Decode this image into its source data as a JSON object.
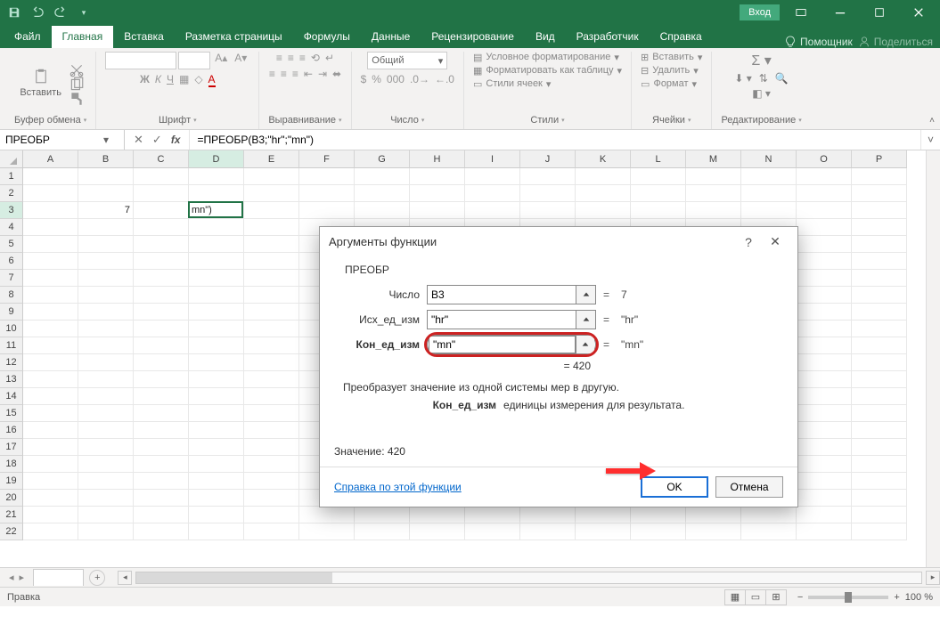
{
  "titlebar": {
    "login": "Вход"
  },
  "tabs": {
    "file": "Файл",
    "items": [
      "Главная",
      "Вставка",
      "Разметка страницы",
      "Формулы",
      "Данные",
      "Рецензирование",
      "Вид",
      "Разработчик",
      "Справка"
    ],
    "active": 0,
    "helper": "Помощник",
    "share": "Поделиться"
  },
  "ribbon": {
    "paste": "Вставить",
    "groups": {
      "clipboard": "Буфер обмена",
      "font": "Шрифт",
      "alignment": "Выравнивание",
      "number": "Число",
      "styles": "Стили",
      "cells": "Ячейки",
      "editing": "Редактирование"
    },
    "number_format": "Общий",
    "cond_format": "Условное форматирование",
    "format_table": "Форматировать как таблицу",
    "cell_styles": "Стили ячеек",
    "insert": "Вставить",
    "delete": "Удалить",
    "format": "Формат"
  },
  "namebox": "ПРЕОБР",
  "formula": "=ПРЕОБР(B3;\"hr\";\"mn\")",
  "columns": [
    "A",
    "B",
    "C",
    "D",
    "E",
    "F",
    "G",
    "H",
    "I",
    "J",
    "K",
    "L",
    "M",
    "N",
    "O",
    "P"
  ],
  "rows_count": 22,
  "selected_col_idx": 3,
  "selected_row_idx": 2,
  "cell_b3": "7",
  "cell_d3": "mn\")",
  "sheet": {
    "add": "+"
  },
  "status": {
    "mode": "Правка",
    "zoom": "100 %"
  },
  "dialog": {
    "title": "Аргументы функции",
    "fn": "ПРЕОБР",
    "args": [
      {
        "label": "Число",
        "value": "B3",
        "result": "7",
        "bold": false
      },
      {
        "label": "Исх_ед_изм",
        "value": "\"hr\"",
        "result": "\"hr\"",
        "bold": false
      },
      {
        "label": "Кон_ед_изм",
        "value": "\"mn\"",
        "result": "\"mn\"",
        "bold": true,
        "highlight": true
      }
    ],
    "overall_result": "420",
    "desc": "Преобразует значение из одной системы мер в другую.",
    "desc2_label": "Кон_ед_изм",
    "desc2_text": "единицы измерения для результата.",
    "value_label": "Значение:",
    "value": "420",
    "help": "Справка по этой функции",
    "ok": "OK",
    "cancel": "Отмена"
  }
}
